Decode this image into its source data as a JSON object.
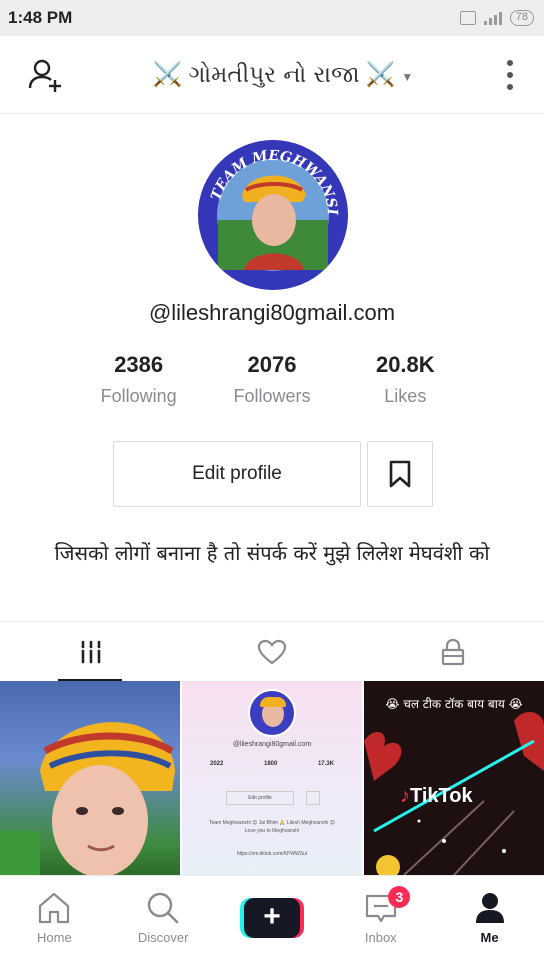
{
  "status": {
    "time": "1:48 PM",
    "battery": "78"
  },
  "header": {
    "title": "ગોમતીપુર નો રાજા",
    "swords": "⚔️"
  },
  "profile": {
    "handle": "@lileshrangi80gmail.com",
    "avatar_ring_text": "TEAM MEGHWANSI",
    "stats": [
      {
        "value": "2386",
        "label": "Following"
      },
      {
        "value": "2076",
        "label": "Followers"
      },
      {
        "value": "20.8K",
        "label": "Likes"
      }
    ],
    "edit_label": "Edit profile",
    "bio": "जिसको लोगों बनाना है तो संपर्क करें मुझे लिलेश मेघवंशी को"
  },
  "tabs": [
    {
      "name": "videos",
      "icon": "grid-icon",
      "active": true
    },
    {
      "name": "liked",
      "icon": "heart-icon",
      "active": false
    },
    {
      "name": "private",
      "icon": "lock-icon",
      "active": false
    }
  ],
  "videos": {
    "v2": {
      "handle": "@lileshrangi80gmail.com",
      "stats": [
        "2022",
        "1800",
        "17.3K"
      ],
      "edit": "Edit profile",
      "bio": "Team Meghwanshi 😊 Jai Bhim 🙏 Lilesh Meghvanshi 😊 Love you to Meghvanshi",
      "link": "https://vm.tiktok.com/KPWWSu/"
    },
    "v3": {
      "caption": "😭 चल टीक टॉक बाय बाय 😭",
      "logo": "TikTok"
    }
  },
  "nav": [
    {
      "label": "Home",
      "icon": "home-icon"
    },
    {
      "label": "Discover",
      "icon": "search-icon"
    },
    {
      "label": "",
      "icon": "plus-icon"
    },
    {
      "label": "Inbox",
      "icon": "inbox-icon",
      "badge": "3"
    },
    {
      "label": "Me",
      "icon": "profile-icon",
      "active": true
    }
  ],
  "colors": {
    "accent": "#fe2c55",
    "cyan": "#25f4ee",
    "text": "#161823",
    "muted": "#8a8b91"
  }
}
